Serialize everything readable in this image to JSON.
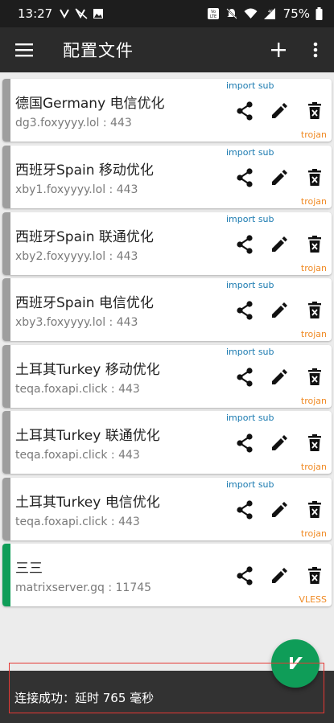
{
  "status_bar": {
    "time": "13:27",
    "battery": "75%",
    "network": "4G"
  },
  "toolbar": {
    "title": "配置文件",
    "menu_icon": "hamburger-menu-icon",
    "add_icon": "plus-icon",
    "more_icon": "more-vert-icon"
  },
  "profiles": [
    {
      "name": "德国Germany 电信优化",
      "address": "dg3.foxyyyy.lol : 443",
      "subscription": "import sub",
      "type": "trojan",
      "active": false
    },
    {
      "name": "西班牙Spain 移动优化",
      "address": "xby1.foxyyyy.lol : 443",
      "subscription": "import sub",
      "type": "trojan",
      "active": false
    },
    {
      "name": "西班牙Spain 联通优化",
      "address": "xby2.foxyyyy.lol : 443",
      "subscription": "import sub",
      "type": "trojan",
      "active": false
    },
    {
      "name": "西班牙Spain 电信优化",
      "address": "xby3.foxyyyy.lol : 443",
      "subscription": "import sub",
      "type": "trojan",
      "active": false
    },
    {
      "name": "土耳其Turkey 移动优化",
      "address": "teqa.foxapi.click : 443",
      "subscription": "import sub",
      "type": "trojan",
      "active": false
    },
    {
      "name": "土耳其Turkey 联通优化",
      "address": "teqa.foxapi.click : 443",
      "subscription": "import sub",
      "type": "trojan",
      "active": false
    },
    {
      "name": "土耳其Turkey 电信优化",
      "address": "teqa.foxapi.click : 443",
      "subscription": "import sub",
      "type": "trojan",
      "active": false
    },
    {
      "name": "三三",
      "address": "matrixserver.gq : 11745",
      "subscription": "",
      "type": "VLESS",
      "active": true
    }
  ],
  "snackbar": {
    "message": "连接成功：延时 765 毫秒"
  },
  "colors": {
    "accent": "#0f9d58",
    "subscription": "#1a7ab0",
    "protocol": "#f08a24",
    "toolbar": "#2b2b2b"
  }
}
